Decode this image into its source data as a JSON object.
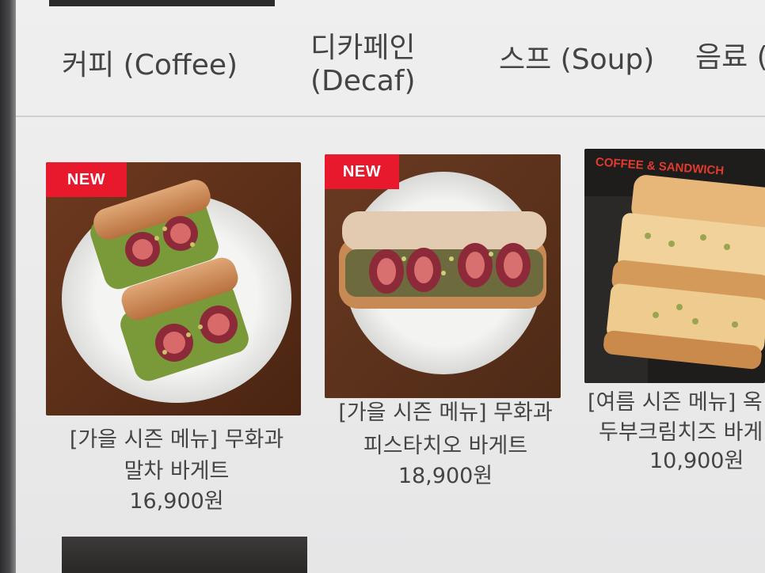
{
  "tabs": [
    {
      "label": "커피 (Coffee)"
    },
    {
      "label_line1": "디카페인",
      "label_line2": "(Decaf)"
    },
    {
      "label": "스프 (Soup)"
    },
    {
      "label": "음료 (D"
    }
  ],
  "products": [
    {
      "badge": "NEW",
      "title_line1": "[가을 시즌 메뉴] 무화과",
      "title_line2": "말차 바게트",
      "price": "16,900원"
    },
    {
      "badge": "NEW",
      "title_line1": "[가을 시즌 메뉴] 무화과",
      "title_line2": "피스타치오 바게트",
      "price": "18,900원"
    },
    {
      "photo_caption": "COFFEE & SANDWICH",
      "title_line1": "[여름 시즌 메뉴] 옥",
      "title_line2": "두부크림치즈 바게",
      "price": "10,900원"
    }
  ],
  "colors": {
    "badge": "#e8192c",
    "active_tab_indicator": "#2b2b2b",
    "background": "#ececec"
  }
}
